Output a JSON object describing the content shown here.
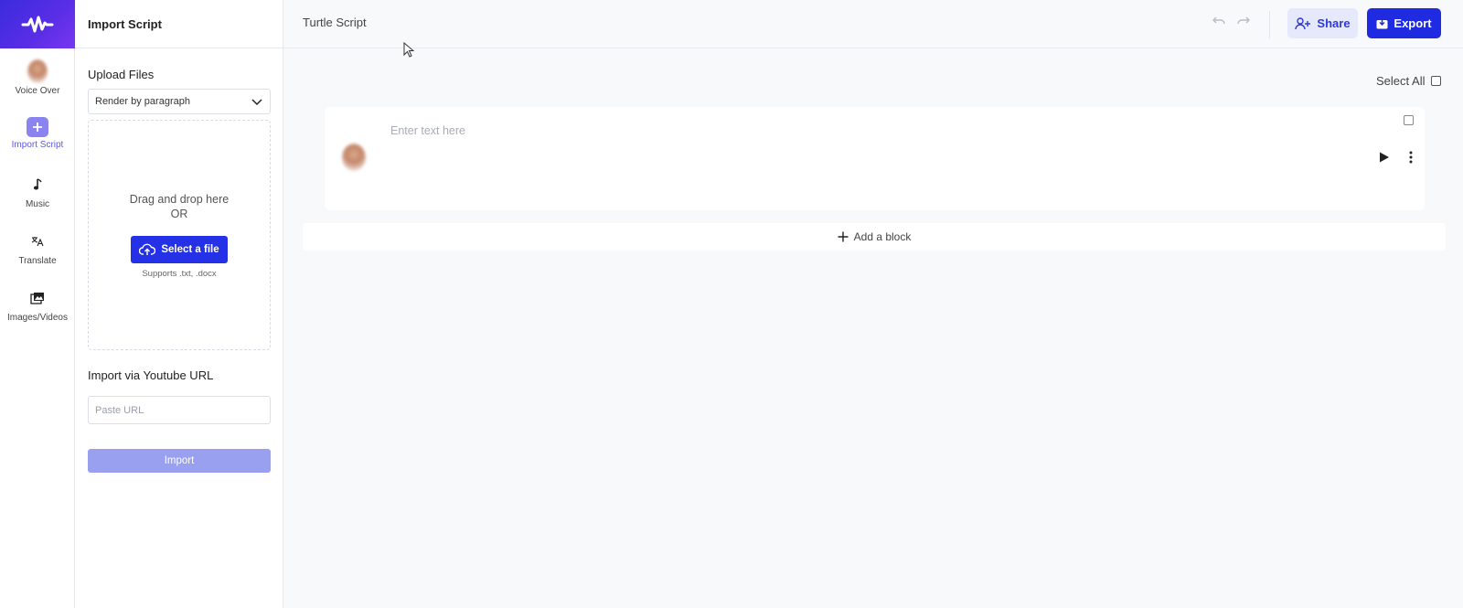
{
  "rail": {
    "items": [
      {
        "label": "Voice Over",
        "icon": "avatar-icon"
      },
      {
        "label": "Import Script",
        "icon": "plus-square-icon"
      },
      {
        "label": "Music",
        "icon": "music-note-icon"
      },
      {
        "label": "Translate",
        "icon": "translate-icon"
      },
      {
        "label": "Images/Videos",
        "icon": "images-icon"
      }
    ],
    "active_index": 1
  },
  "panel": {
    "title": "Import Script",
    "upload_title": "Upload Files",
    "render_mode": "Render by paragraph",
    "drop_text_1": "Drag and drop here",
    "drop_text_2": "OR",
    "select_file_label": "Select a file",
    "supports_text": "Supports .txt, .docx",
    "youtube_title": "Import via Youtube URL",
    "url_placeholder": "Paste URL",
    "import_label": "Import"
  },
  "topbar": {
    "doc_title": "Turtle Script",
    "share_label": "Share",
    "export_label": "Export"
  },
  "main": {
    "select_all_label": "Select All",
    "blocks": [
      {
        "placeholder": "Enter text here"
      }
    ],
    "add_block_label": "Add a block"
  },
  "colors": {
    "accent": "#1f2be0",
    "accent_light": "#e6e8fb",
    "import_disabled": "#9aa0f0",
    "active_nav": "#5b5be0"
  }
}
